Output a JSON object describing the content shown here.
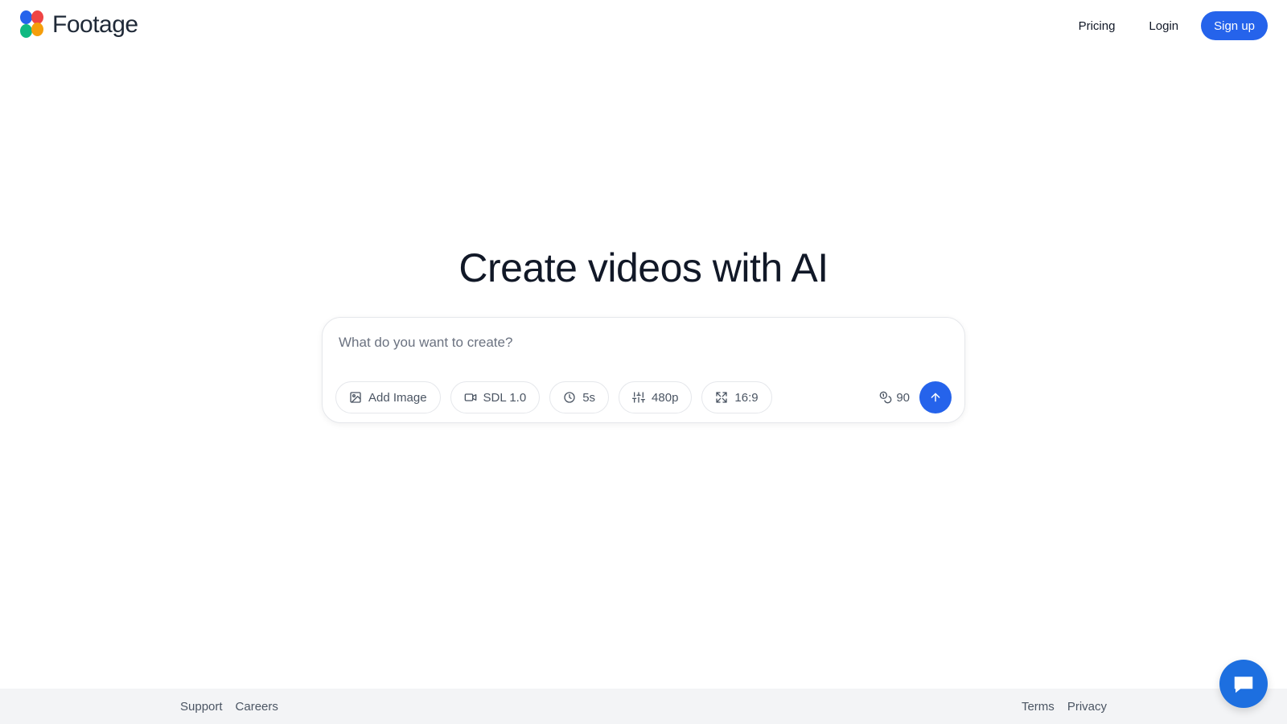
{
  "brand": {
    "name": "Footage",
    "colors": {
      "primary": "#2563eb",
      "logo_blue": "#2563eb",
      "logo_red": "#ef4444",
      "logo_green": "#10b981",
      "logo_yellow": "#f59e0b"
    }
  },
  "nav": {
    "pricing": "Pricing",
    "login": "Login",
    "signup": "Sign up"
  },
  "hero": {
    "title": "Create videos with AI"
  },
  "composer": {
    "placeholder": "What do you want to create?",
    "options": {
      "add_image": {
        "label": "Add Image",
        "icon": "image-icon"
      },
      "model": {
        "label": "SDL 1.0",
        "icon": "video-camera-icon"
      },
      "duration": {
        "label": "5s",
        "icon": "clock-icon"
      },
      "resolution": {
        "label": "480p",
        "icon": "sliders-icon"
      },
      "aspect_ratio": {
        "label": "16:9",
        "icon": "expand-icon"
      }
    },
    "credits": {
      "value": "90",
      "icon": "coins-icon"
    },
    "submit_icon": "arrow-up-icon"
  },
  "footer": {
    "support": "Support",
    "careers": "Careers",
    "terms": "Terms",
    "privacy": "Privacy"
  },
  "chat": {
    "icon": "chat-bubble-icon"
  }
}
